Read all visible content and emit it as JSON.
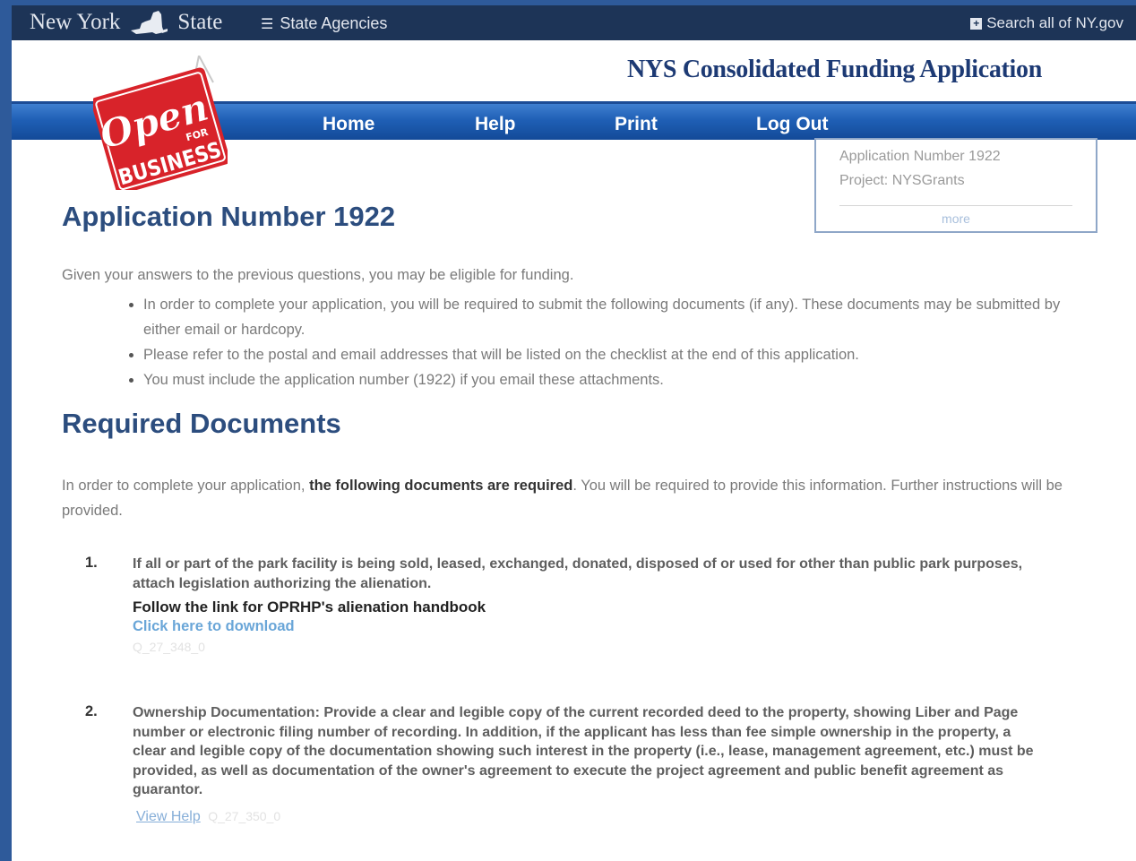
{
  "nybar": {
    "brand_left": "New York",
    "brand_right": "State",
    "agencies": "State Agencies",
    "search": "Search all of NY.gov"
  },
  "header": {
    "title": "NYS Consolidated Funding Application",
    "logo_line1": "Open",
    "logo_line2": "FOR",
    "logo_line3": "BUSINESS"
  },
  "nav": {
    "items": [
      "Home",
      "Help",
      "Print",
      "Log Out"
    ]
  },
  "infobox": {
    "application_number": "Application Number 1922",
    "project": "Project: NYSGrants",
    "more": "more"
  },
  "main": {
    "title": "Application Number 1922",
    "intro": "Given your answers to the previous questions, you may be eligible for funding.",
    "bullets": [
      "In order to complete your application, you will be required to submit the following documents (if any). These documents may be submitted by either email or hardcopy.",
      "Please refer to the postal and email addresses that will be listed on the checklist at the end of this application.",
      "You must include the application number (1922) if you email these attachments."
    ],
    "required_title": "Required Documents",
    "required_intro_pre": "In order to complete your application, ",
    "required_intro_bold": "the following documents are required",
    "required_intro_post": ". You will be required to provide this information. Further instructions will be provided.",
    "documents": [
      {
        "number": "1.",
        "text": "If all or part of the park facility is being sold, leased, exchanged, donated, disposed of or used for other than public park purposes, attach legislation authorizing the alienation.",
        "follow": "Follow the link for OPRHP's alienation handbook",
        "link": "Click here to download",
        "code": "Q_27_348_0"
      },
      {
        "number": "2.",
        "text": "Ownership Documentation: Provide a clear and legible copy of the current recorded deed to the property, showing Liber and Page number or electronic filing number of recording. In addition, if the applicant has less than fee simple ownership in the property, a clear and legible copy of the documentation showing such interest in the property (i.e., lease, management agreement, etc.) must be provided, as well as documentation of the owner's agreement to execute the project agreement and public benefit agreement as guarantor.",
        "link": "View Help",
        "code": "Q_27_350_0"
      }
    ]
  },
  "colors": {
    "nybar": "#1d3457",
    "nav": "#1f5fb5",
    "heading": "#2c4d7e",
    "logo_red": "#d8232a",
    "link": "#6aa6d8"
  }
}
